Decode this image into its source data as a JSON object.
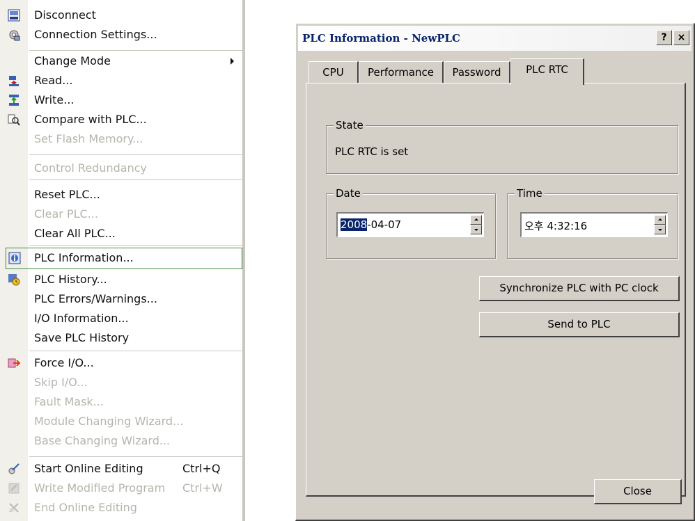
{
  "menu": {
    "items": [
      {
        "label": "Disconnect",
        "icon": "disconnect-icon"
      },
      {
        "label": "Connection Settings...",
        "icon": "connection-settings-icon"
      },
      {
        "label": "Change Mode",
        "has_submenu": true
      },
      {
        "label": "Read...",
        "icon": "read-icon"
      },
      {
        "label": "Write...",
        "icon": "write-icon"
      },
      {
        "label": "Compare with PLC...",
        "icon": "compare-icon"
      },
      {
        "label": "Set Flash Memory...",
        "disabled": true
      },
      {
        "label": "Control Redundancy",
        "disabled": true
      },
      {
        "label": "Reset PLC..."
      },
      {
        "label": "Clear PLC...",
        "disabled": true
      },
      {
        "label": "Clear All PLC..."
      },
      {
        "label": "PLC Information...",
        "icon": "plc-information-icon",
        "selected": true
      },
      {
        "label": "PLC History...",
        "icon": "plc-history-icon"
      },
      {
        "label": "PLC Errors/Warnings..."
      },
      {
        "label": "I/O Information..."
      },
      {
        "label": "Save PLC History"
      },
      {
        "label": "Force I/O...",
        "icon": "force-io-icon"
      },
      {
        "label": "Skip I/O...",
        "disabled": true
      },
      {
        "label": "Fault Mask...",
        "disabled": true
      },
      {
        "label": "Module Changing Wizard...",
        "disabled": true
      },
      {
        "label": "Base Changing Wizard...",
        "disabled": true
      },
      {
        "label": "Start Online Editing",
        "shortcut": "Ctrl+Q",
        "icon": "start-online-editing-icon"
      },
      {
        "label": "Write Modified Program",
        "shortcut": "Ctrl+W",
        "disabled": true,
        "icon": "write-modified-program-icon"
      },
      {
        "label": "End Online Editing",
        "disabled": true,
        "icon": "end-online-editing-icon"
      }
    ]
  },
  "dialog": {
    "title": "PLC Information - NewPLC",
    "help_label": "?",
    "close_x_label": "×",
    "tabs": [
      "CPU",
      "Performance",
      "Password",
      "PLC RTC"
    ],
    "active_tab": "PLC RTC",
    "state": {
      "legend": "State",
      "text": "PLC RTC is set"
    },
    "date": {
      "legend": "Date",
      "year": "2008",
      "rest": "-04-07"
    },
    "time": {
      "legend": "Time",
      "value": "오후  4:32:16"
    },
    "sync_button": "Synchronize PLC with PC clock",
    "send_button": "Send to PLC",
    "close_button": "Close"
  },
  "colors": {
    "dialog_bg": "#d4d0c8",
    "title_text": "#0a246a",
    "selection_border": "#3c8a3c",
    "highlight_bg": "#0a246a"
  }
}
